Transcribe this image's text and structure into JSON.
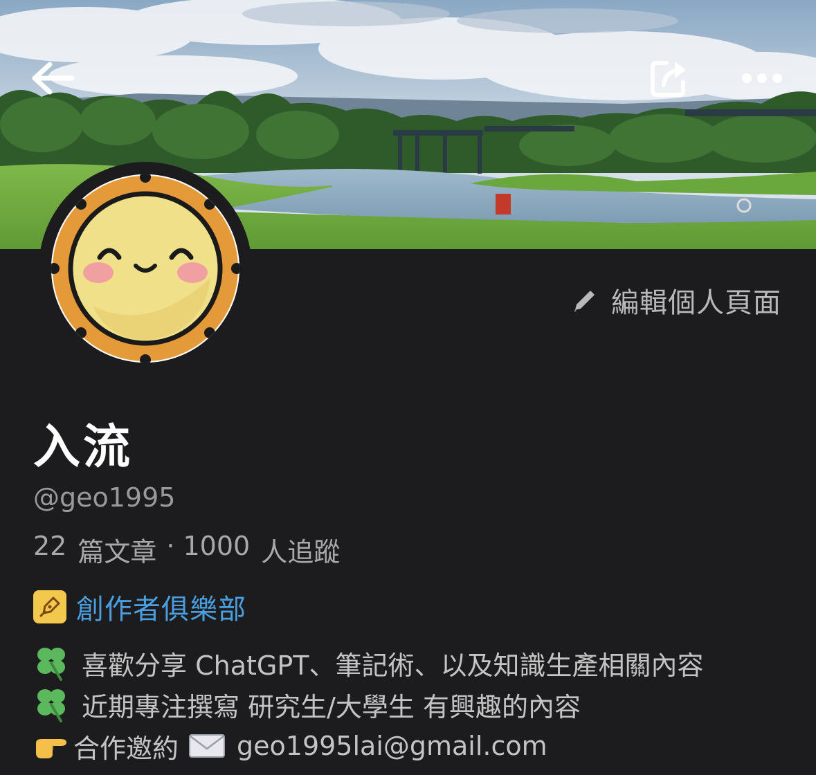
{
  "header": {
    "back_icon": "arrow-left-icon",
    "share_icon": "share-icon",
    "more_icon": "more-horizontal-icon"
  },
  "profile": {
    "edit_label": "編輯個人頁面",
    "display_name": "入流",
    "handle": "@geo1995",
    "articles_count": "22",
    "articles_label": "篇文章",
    "separator": "·",
    "followers_count": "1000",
    "followers_label": "人追蹤",
    "club_label": "創作者俱樂部"
  },
  "bio": {
    "line1": "喜歡分享 ChatGPT、筆記術、以及知識生產相關內容",
    "line2": "近期專注撰寫 研究生/大學生 有興趣的內容",
    "line3_prefix": "合作邀約",
    "email": "geo1995lai@gmail.com"
  },
  "colors": {
    "background": "#1c1c1e",
    "link": "#4a9fe0",
    "club_badge": "#f2c94c"
  }
}
